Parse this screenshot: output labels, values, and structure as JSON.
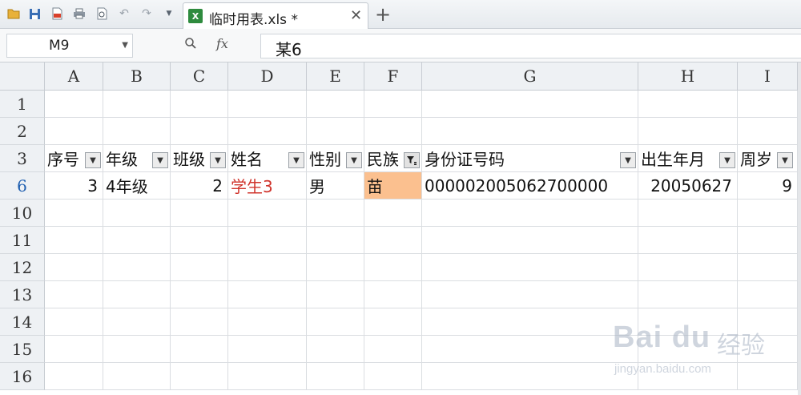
{
  "toolbar": {
    "icons": [
      "open-folder-icon",
      "save-icon",
      "export-pdf-icon",
      "print-icon",
      "print-preview-icon",
      "undo-icon",
      "redo-icon",
      "dropdown-icon"
    ]
  },
  "tab": {
    "badge": "X",
    "title": "临时用表.xls *",
    "close": "✕",
    "new": "+"
  },
  "formula_bar": {
    "cell_ref": "M9",
    "fx": "fx",
    "content": "某6"
  },
  "columns": [
    "A",
    "B",
    "C",
    "D",
    "E",
    "F",
    "G",
    "H",
    "I"
  ],
  "rows": [
    "1",
    "2",
    "3",
    "6",
    "10",
    "11",
    "12",
    "13",
    "14",
    "15",
    "16"
  ],
  "header_row": [
    "序号",
    "年级",
    "班级",
    "姓名",
    "性别",
    "民族",
    "身份证号码",
    "出生年月",
    "周岁"
  ],
  "data_row": {
    "seq": "3",
    "grade": "4年级",
    "class": "2",
    "name": "学生3",
    "gender": "男",
    "ethnicity": "苗",
    "id_number": "000002005062700000",
    "birth": "20050627",
    "age": "9"
  },
  "colors": {
    "filtered_cell": "#fbc08f",
    "name_text": "#d0342c",
    "row_highlight": "#1f5fb0"
  },
  "watermark": {
    "logo": "Bai du",
    "brand": "经验",
    "url": "jingyan.baidu.com"
  }
}
